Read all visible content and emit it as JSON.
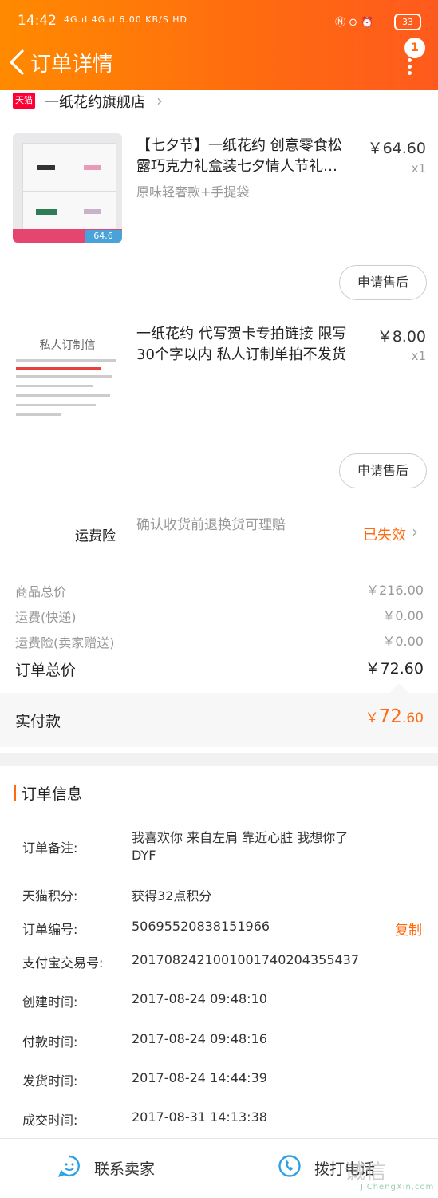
{
  "status_bar": {
    "time": "14:42",
    "network": "4G.ıl 4G.ıl 6.00 KB/S HD",
    "right_icons": "Ⓝ ⊙ ⏰",
    "battery": "33"
  },
  "header": {
    "title": "订单详情",
    "badge": "1"
  },
  "shop": {
    "logo_text": "天猫",
    "name": "一纸花约旗舰店"
  },
  "items": [
    {
      "title": "【七夕节】一纸花约 创意零食松露巧克力礼盒装七夕情人节礼…",
      "price": "￥64.60",
      "qty": "x1",
      "spec": "原味轻奢款+手提袋",
      "thumb_price": "64.6",
      "after_sale_label": "申请售后"
    },
    {
      "title": "一纸花约 代写贺卡专拍链接 限写30个字以内 私人订制单拍不发货",
      "price": "￥8.00",
      "qty": "x1",
      "thumb_title": "私人订制信",
      "after_sale_label": "申请售后"
    }
  ],
  "freight_insurance": {
    "label": "运费险",
    "desc": "确认收货前退换货可理赔",
    "status": "已失效"
  },
  "summary": {
    "goods_total_label": "商品总价",
    "goods_total": "￥216.00",
    "shipping_label": "运费(快递)",
    "shipping": "￥0.00",
    "ins_label": "运费险(卖家赠送)",
    "ins": "￥0.00",
    "order_total_label": "订单总价",
    "order_total": "￥72.60",
    "paid_label": "实付款",
    "paid_symbol": "￥",
    "paid_int": "72",
    "paid_dec": ".60"
  },
  "order_info": {
    "title": "订单信息",
    "rows": [
      {
        "label": "订单备注:",
        "value": "我喜欢你 来自左肩 靠近心脏 我想你了 DYF"
      },
      {
        "label": "天猫积分:",
        "value": "获得32点积分"
      },
      {
        "label": "订单编号:",
        "value": "50695520838151966",
        "action": "复制"
      },
      {
        "label": "支付宝交易号:",
        "value": "2017082421001001740204355437"
      },
      {
        "label": "创建时间:",
        "value": "2017-08-24 09:48:10"
      },
      {
        "label": "付款时间:",
        "value": "2017-08-24 09:48:16"
      },
      {
        "label": "发货时间:",
        "value": "2017-08-24 14:44:39"
      },
      {
        "label": "成交时间:",
        "value": "2017-08-31 14:13:38"
      }
    ]
  },
  "bottom": {
    "contact_label": "联系卖家",
    "call_label": "拨打电话"
  },
  "watermark": {
    "main": "诚信",
    "sub": "JiChengXin.com"
  },
  "colors": {
    "accent": "#ff6a10",
    "tmall_red": "#ff0036",
    "muted": "#999999"
  }
}
